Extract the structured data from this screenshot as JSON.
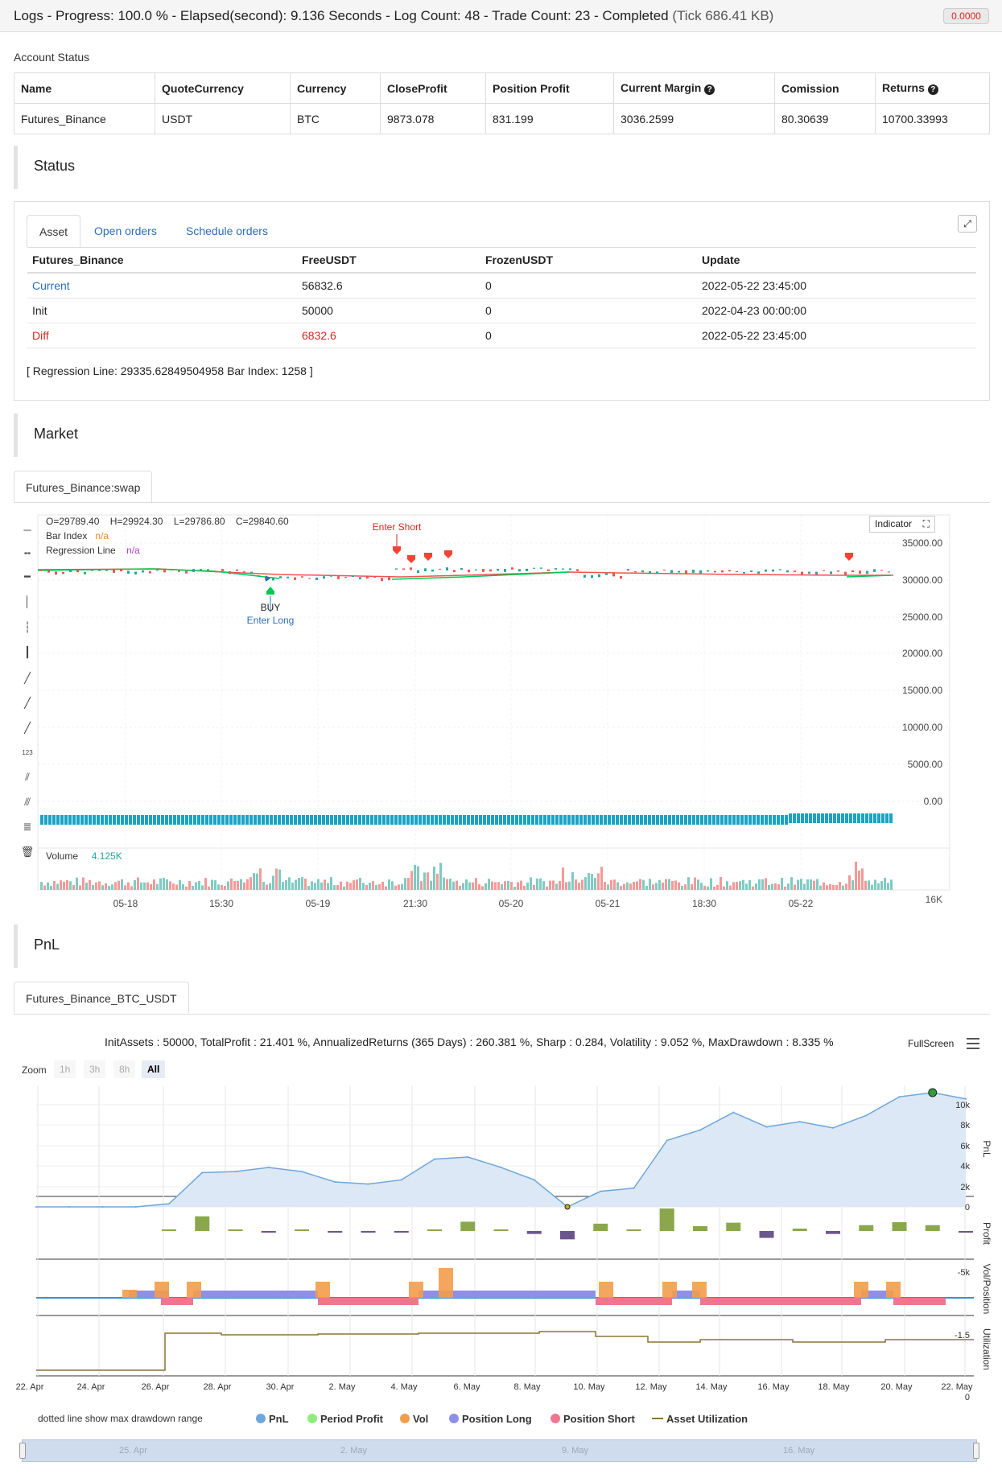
{
  "topbar": {
    "title": "Logs - Progress: 100.0 % - Elapsed(second): 9.136 Seconds - Log Count: 48 - Trade Count: 23 - Completed",
    "tick": "(Tick 686.41 KB)",
    "badge": "0.0000"
  },
  "account": {
    "caption": "Account Status",
    "columns": [
      "Name",
      "QuoteCurrency",
      "Currency",
      "CloseProfit",
      "Position Profit",
      "Current Margin",
      "Comission",
      "Returns"
    ],
    "row": [
      "Futures_Binance",
      "USDT",
      "BTC",
      "9873.078",
      "831.199",
      "3036.2599",
      "80.30639",
      "10700.33993"
    ]
  },
  "status": {
    "heading": "Status",
    "tabs": [
      "Asset",
      "Open orders",
      "Schedule orders"
    ],
    "columns": [
      "Futures_Binance",
      "FreeUSDT",
      "FrozenUSDT",
      "Update"
    ],
    "rows": [
      [
        "Current",
        "56832.6",
        "0",
        "2022-05-22 23:45:00"
      ],
      [
        "Init",
        "50000",
        "0",
        "2022-04-23 00:00:00"
      ],
      [
        "Diff",
        "6832.6",
        "0",
        "2022-05-22 23:45:00"
      ]
    ],
    "regression_text": "[ Regression Line: 29335.62849504958 Bar Index: 1258 ]"
  },
  "market": {
    "heading": "Market",
    "tab": "Futures_Binance:swap",
    "ohlc": {
      "o": "O=29789.40",
      "h": "H=29924.30",
      "l": "L=29786.80",
      "c": "C=29840.60"
    },
    "bar_index_label": "Bar Index",
    "bar_index_value": "n/a",
    "regression_label": "Regression Line",
    "regression_value": "n/a",
    "indicator_btn": "Indicator",
    "enter_short": "Enter Short",
    "enter_long": "Enter Long",
    "buy_label": "BUY",
    "volume_label": "Volume",
    "volume_value": "4.125K",
    "volume_axis": "16K",
    "y_ticks": [
      "35000.00",
      "30000.00",
      "25000.00",
      "20000.00",
      "15000.00",
      "10000.00",
      "5000.00",
      "0.00"
    ],
    "x_ticks": [
      "05-18",
      "15:30",
      "05-19",
      "21:30",
      "05-20",
      "05-21",
      "18:30",
      "05-22"
    ]
  },
  "pnl": {
    "heading": "PnL",
    "tab": "Futures_Binance_BTC_USDT",
    "stats": "InitAssets : 50000, TotalProfit : 21.401 %, AnnualizedReturns (365 Days) : 260.381 %, Sharp : 0.284, Volatility : 9.052 %, MaxDrawdown : 8.335 %",
    "fullscreen": "FullScreen",
    "zoom_label": "Zoom",
    "zoom_buttons": [
      "1h",
      "3h",
      "8h",
      "All"
    ],
    "pnl_ticks": [
      "10k",
      "8k",
      "6k",
      "4k",
      "2k",
      "0"
    ],
    "profit_tick": "-5k",
    "vol_tick": "-1.5",
    "util_tick": "0",
    "axis_titles": [
      "PnL",
      "Profit",
      "Vol/Position",
      "Utilization"
    ],
    "x_ticks": [
      "22. Apr",
      "24. Apr",
      "26. Apr",
      "28. Apr",
      "30. Apr",
      "2. May",
      "4. May",
      "6. May",
      "8. May",
      "10. May",
      "12. May",
      "14. May",
      "16. May",
      "18. May",
      "20. May",
      "22. May"
    ],
    "note": "dotted line show max drawdown range",
    "legend": [
      "PnL",
      "Period Profit",
      "Vol",
      "Position Long",
      "Position Short",
      "Asset Utilization"
    ],
    "nav_ticks": [
      "25. Apr",
      "2. May",
      "9. May",
      "16. May"
    ]
  },
  "colors": {
    "pnl_line": "#6ea6dc",
    "profit_up": "#8aa84b",
    "profit_down": "#6b568e",
    "vol": "#f39c4a",
    "pos_long": "#8f8fe6",
    "pos_short": "#ef7690",
    "util": "#8a7536",
    "candle_up": "#26a69a",
    "candle_down": "#ef5350"
  },
  "chart_data": [
    {
      "type": "line",
      "title": "",
      "series": [
        {
          "name": "PnL",
          "values": [
            0,
            0,
            0,
            0,
            300,
            3300,
            3400,
            3800,
            3400,
            2400,
            2200,
            2600,
            4600,
            4800,
            3800,
            2600,
            0,
            1500,
            1800,
            6400,
            7400,
            9100,
            7700,
            8200,
            7600,
            8800,
            10600,
            11000,
            10400
          ]
        }
      ],
      "ylim": [
        0,
        11000
      ]
    },
    {
      "type": "bar",
      "series": [
        {
          "name": "Period Profit",
          "values": [
            0,
            0,
            0,
            0,
            300,
            3000,
            100,
            -100,
            300,
            -300,
            -300,
            -200,
            300,
            1900,
            100,
            -600,
            -1700,
            1500,
            300,
            4600,
            1000,
            1700,
            -1400,
            500,
            -600,
            1200,
            1800,
            1200,
            -200
          ]
        }
      ]
    }
  ]
}
